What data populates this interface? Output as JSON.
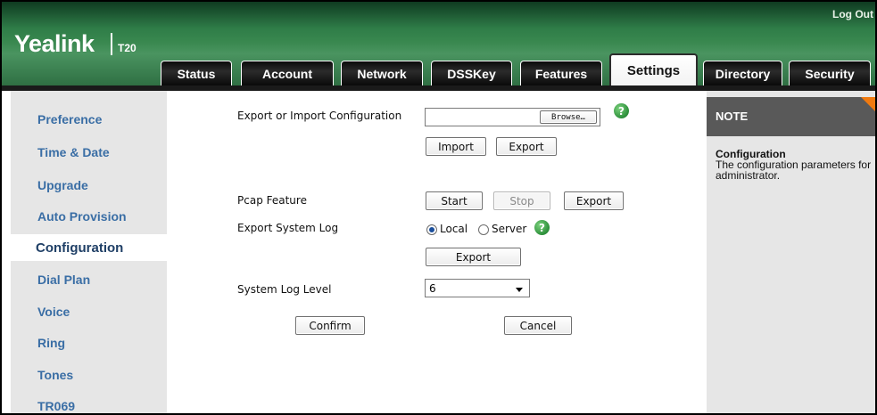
{
  "brand": {
    "name": "Yealink",
    "model": "T20"
  },
  "header": {
    "logout": "Log Out"
  },
  "tabs": [
    {
      "label": "Status",
      "active": false
    },
    {
      "label": "Account",
      "active": false
    },
    {
      "label": "Network",
      "active": false
    },
    {
      "label": "DSSKey",
      "active": false
    },
    {
      "label": "Features",
      "active": false
    },
    {
      "label": "Settings",
      "active": true
    },
    {
      "label": "Directory",
      "active": false
    },
    {
      "label": "Security",
      "active": false
    }
  ],
  "sidebar": {
    "items": [
      {
        "label": "Preference"
      },
      {
        "label": "Time & Date"
      },
      {
        "label": "Upgrade"
      },
      {
        "label": "Auto Provision"
      },
      {
        "label": "Configuration",
        "active": true
      },
      {
        "label": "Dial Plan"
      },
      {
        "label": "Voice"
      },
      {
        "label": "Ring"
      },
      {
        "label": "Tones"
      },
      {
        "label": "TR069"
      }
    ]
  },
  "main": {
    "export_import": {
      "label": "Export or Import Configuration",
      "file_value": "",
      "browse": "Browse…",
      "import": "Import",
      "export": "Export"
    },
    "pcap": {
      "label": "Pcap Feature",
      "start": "Start",
      "stop": "Stop",
      "export": "Export"
    },
    "syslog": {
      "label": "Export System Log",
      "local": "Local",
      "server": "Server",
      "selected": "Local",
      "export": "Export"
    },
    "log_level": {
      "label": "System Log Level",
      "value": "6"
    },
    "confirm": "Confirm",
    "cancel": "Cancel"
  },
  "note": {
    "title": "NOTE",
    "subtitle": "Configuration",
    "description": "The configuration parameters for administrator."
  },
  "colors": {
    "header_green": "#39884f",
    "link_blue": "#3a6ea5",
    "note_accent": "#f07a10",
    "help_green": "#2c8f3a"
  },
  "icons": {
    "help": "help-icon",
    "dropdown": "chevron-down-icon",
    "note_corner": "corner-flag-icon"
  }
}
